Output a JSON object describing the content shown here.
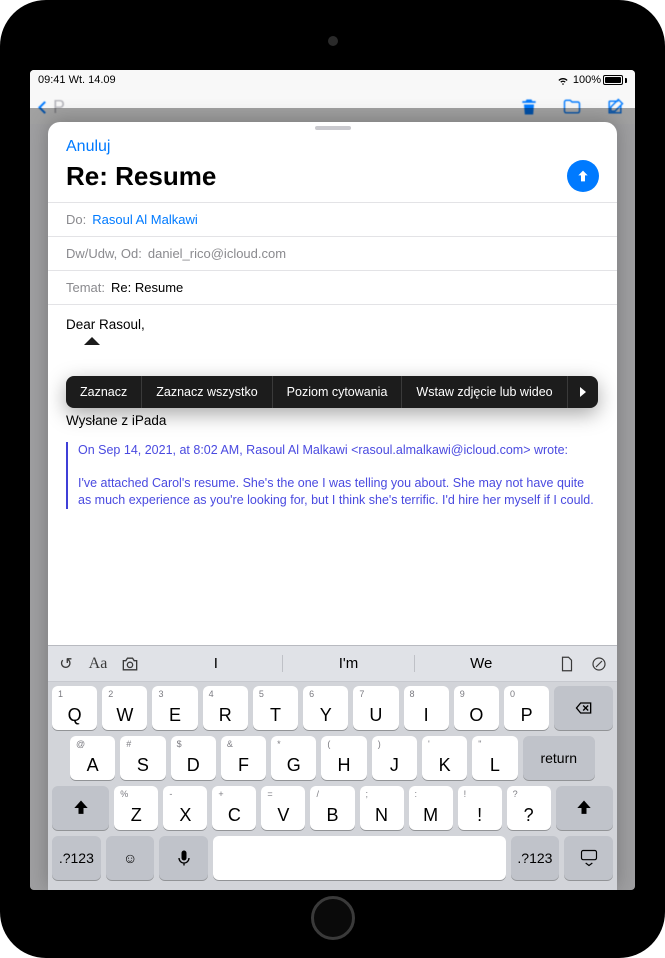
{
  "status_bar": {
    "time": "09:41  Wt. 14.09",
    "battery_pct": "100%"
  },
  "mail_toolbar": {
    "back_label": "P"
  },
  "compose": {
    "cancel": "Anuluj",
    "title": "Re: Resume",
    "to_label": "Do:",
    "to_value": "Rasoul Al Malkawi",
    "cc_label": "Dw/Udw, Od:",
    "cc_value": "daniel_rico@icloud.com",
    "subject_label": "Temat:",
    "subject_value": "Re: Resume",
    "body_greeting": "Dear Rasoul,",
    "signature": "Wysłane z iPada",
    "quote_meta": "On Sep 14, 2021, at 8:02 AM, Rasoul Al Malkawi <rasoul.almalkawi@icloud.com> wrote:",
    "quote_body": "I've attached Carol's resume. She's the one I was telling you about. She may not have quite as much experience as you're looking for, but I think she's terrific. I'd hire her myself if I could."
  },
  "popover": {
    "select": "Zaznacz",
    "select_all": "Zaznacz wszystko",
    "quote_level": "Poziom cytowania",
    "insert_media": "Wstaw zdjęcie lub wideo"
  },
  "keyboard": {
    "preds": [
      "I",
      "I'm",
      "We"
    ],
    "row1_subs": [
      "1",
      "2",
      "3",
      "4",
      "5",
      "6",
      "7",
      "8",
      "9",
      "0"
    ],
    "row1": [
      "Q",
      "W",
      "E",
      "R",
      "T",
      "Y",
      "U",
      "I",
      "O",
      "P"
    ],
    "row2_subs": [
      "@",
      "#",
      "$",
      "&",
      "*",
      "(",
      ")",
      "'",
      "\""
    ],
    "row2": [
      "A",
      "S",
      "D",
      "F",
      "G",
      "H",
      "J",
      "K",
      "L"
    ],
    "row3_subs": [
      "%",
      "-",
      "+",
      "=",
      "/",
      ";",
      ":",
      "!",
      "?"
    ],
    "row3": [
      "Z",
      "X",
      "C",
      "V",
      "B",
      "N",
      "M",
      "!",
      "?"
    ],
    "return": "return",
    "numkey": ".?123"
  }
}
